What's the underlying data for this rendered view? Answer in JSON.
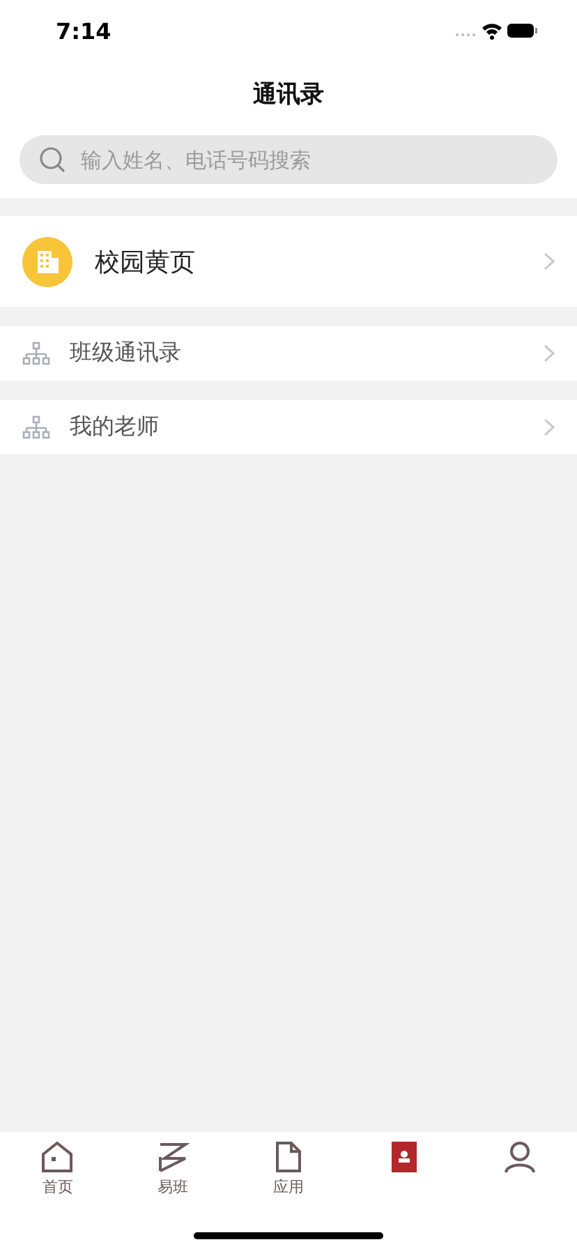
{
  "status_bar": {
    "time": "7:14"
  },
  "title": "通讯录",
  "search": {
    "placeholder": "输入姓名、电话号码搜索"
  },
  "entries": [
    {
      "kind": "featured",
      "label": "校园黄页"
    },
    {
      "kind": "group",
      "label": "班级通讯录"
    },
    {
      "kind": "group",
      "label": "我的老师"
    }
  ],
  "tabs": [
    {
      "kind": "home",
      "label": "首页",
      "selected": false
    },
    {
      "kind": "class",
      "label": "易班",
      "selected": false
    },
    {
      "kind": "apps",
      "label": "应用",
      "selected": false
    },
    {
      "kind": "contacts",
      "selected": true
    },
    {
      "kind": "person",
      "selected": false
    }
  ]
}
